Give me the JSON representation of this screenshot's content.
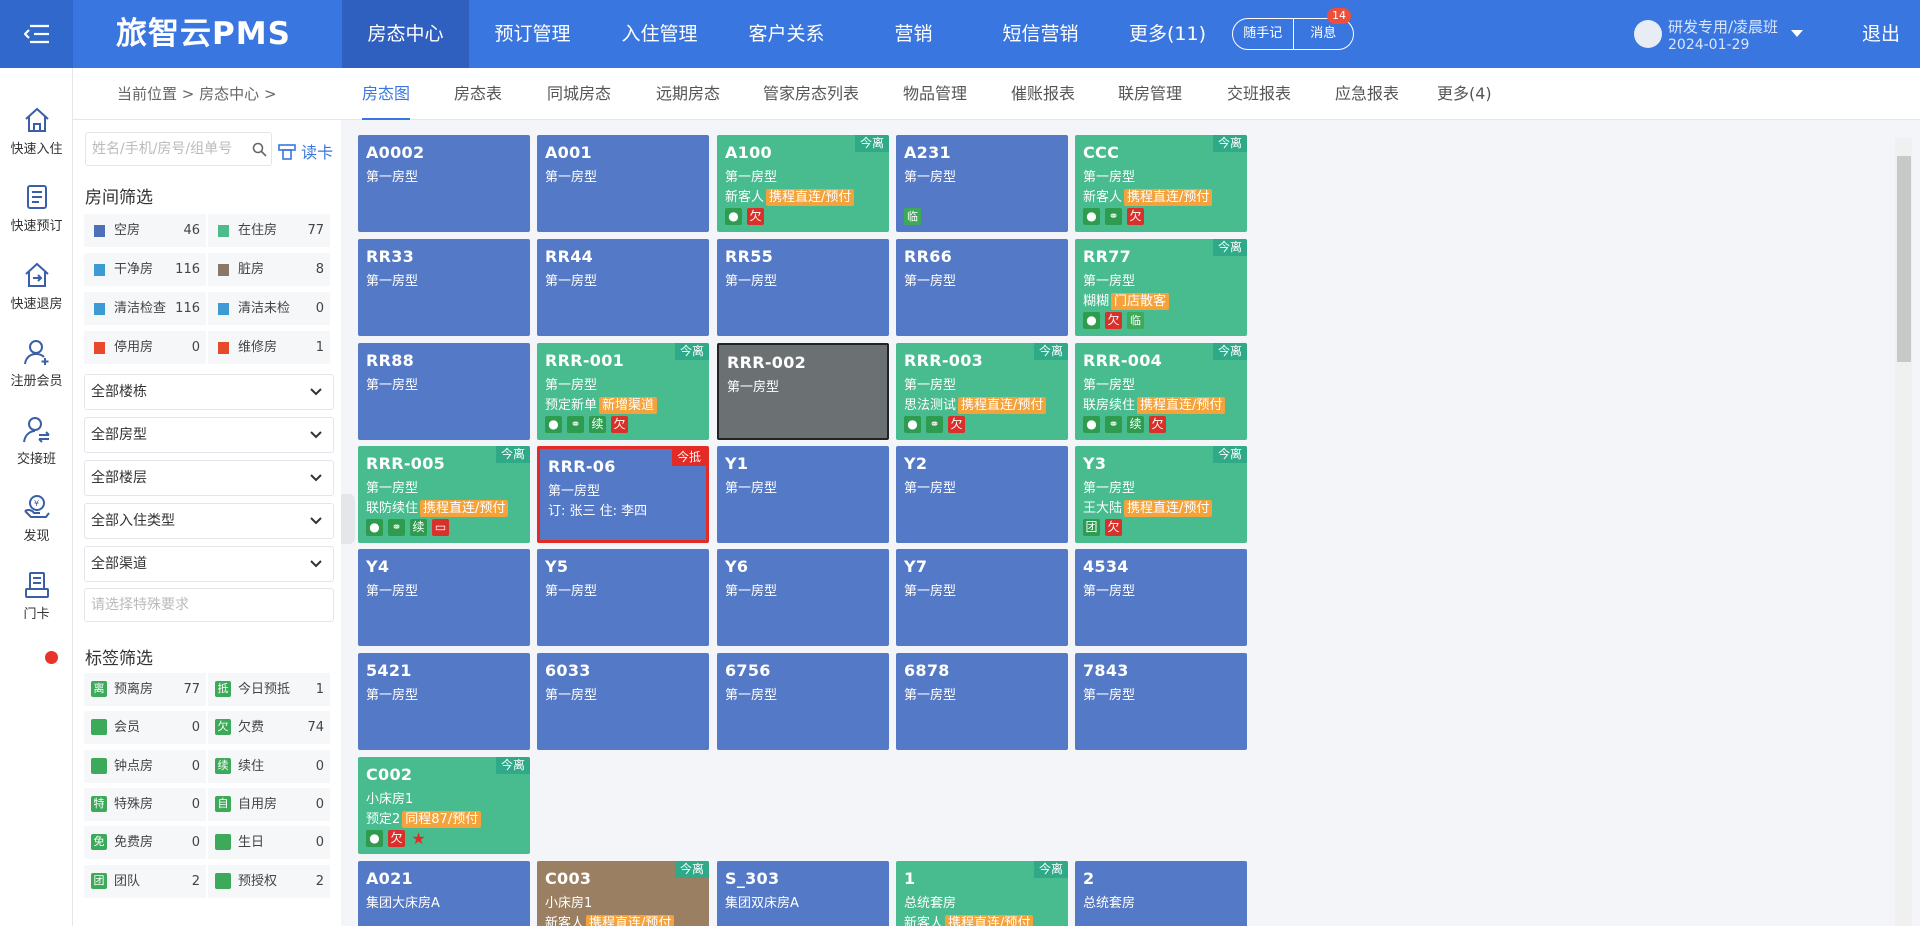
{
  "app": {
    "logo": "旅智云PMS",
    "logout": "退出",
    "user_name": "研发专用/凌晨班",
    "user_date": "2024-01-29",
    "memo_label": "随手记",
    "msg_label": "消息",
    "msg_count": "14"
  },
  "topnav": [
    {
      "label": "房态中心"
    },
    {
      "label": "预订管理"
    },
    {
      "label": "入住管理"
    },
    {
      "label": "客户关系"
    },
    {
      "label": "营销"
    },
    {
      "label": "短信营销"
    },
    {
      "label": "更多(11)"
    }
  ],
  "leftbar": [
    {
      "label": "快速入住",
      "icon": "home-enter-icon"
    },
    {
      "label": "快速预订",
      "icon": "booking-icon"
    },
    {
      "label": "快速退房",
      "icon": "checkout-icon"
    },
    {
      "label": "注册会员",
      "icon": "user-add-icon"
    },
    {
      "label": "交接班",
      "icon": "handover-icon"
    },
    {
      "label": "发现",
      "icon": "discover-icon"
    },
    {
      "label": "门卡",
      "icon": "door-card-icon"
    }
  ],
  "breadcrumb": {
    "prefix": "当前位置",
    "current": "房态中心",
    "sep": ">"
  },
  "subtabs": [
    {
      "label": "房态图"
    },
    {
      "label": "房态表"
    },
    {
      "label": "同城房态"
    },
    {
      "label": "远期房态"
    },
    {
      "label": "管家房态列表"
    },
    {
      "label": "物品管理"
    },
    {
      "label": "催账报表"
    },
    {
      "label": "联房管理"
    },
    {
      "label": "交班报表"
    },
    {
      "label": "应急报表"
    },
    {
      "label": "更多(4)"
    }
  ],
  "filter": {
    "search_placeholder": "姓名/手机/房号/组单号",
    "read_card": "读卡",
    "room_filter_title": "房间筛选",
    "statuses": [
      {
        "label": "空房",
        "count": "46",
        "color": "#4f6fb8"
      },
      {
        "label": "在住房",
        "count": "77",
        "color": "#4dbb8c"
      },
      {
        "label": "干净房",
        "count": "116",
        "color": "#3d9bd4"
      },
      {
        "label": "脏房",
        "count": "8",
        "color": "#8a7766"
      },
      {
        "label": "清洁检查",
        "count": "116",
        "color": "#3d9bd4"
      },
      {
        "label": "清洁未检",
        "count": "0",
        "color": "#3d9bd4"
      },
      {
        "label": "停用房",
        "count": "0",
        "color": "#e64a2e"
      },
      {
        "label": "维修房",
        "count": "1",
        "color": "#e64a2e"
      }
    ],
    "selects": [
      {
        "label": "全部楼栋"
      },
      {
        "label": "全部房型"
      },
      {
        "label": "全部楼层"
      },
      {
        "label": "全部入住类型"
      },
      {
        "label": "全部渠道"
      }
    ],
    "special_placeholder": "请选择特殊要求",
    "tag_filter_title": "标签筛选",
    "tags": [
      {
        "glyph": "离",
        "label": "预离房",
        "count": "77"
      },
      {
        "glyph": "抵",
        "label": "今日预抵",
        "count": "1"
      },
      {
        "glyph": "",
        "label": "会员",
        "count": "0"
      },
      {
        "glyph": "欠",
        "label": "欠费",
        "count": "74"
      },
      {
        "glyph": "",
        "label": "钟点房",
        "count": "0"
      },
      {
        "glyph": "续",
        "label": "续住",
        "count": "0"
      },
      {
        "glyph": "特",
        "label": "特殊房",
        "count": "0"
      },
      {
        "glyph": "自",
        "label": "自用房",
        "count": "0"
      },
      {
        "glyph": "免",
        "label": "免费房",
        "count": "0"
      },
      {
        "glyph": "",
        "label": "生日",
        "count": "0"
      },
      {
        "glyph": "团",
        "label": "团队",
        "count": "2"
      },
      {
        "glyph": "",
        "label": "预授权",
        "count": "2"
      }
    ]
  },
  "rooms": [
    {
      "no": "A0002",
      "type": "第一房型",
      "color": "blue"
    },
    {
      "no": "A001",
      "type": "第一房型",
      "color": "blue"
    },
    {
      "no": "A100",
      "type": "第一房型",
      "color": "green",
      "corner": "今离",
      "guest": "新客人",
      "source": "携程直连/预付",
      "icons": [
        "person",
        "owe"
      ]
    },
    {
      "no": "A231",
      "type": "第一房型",
      "color": "blue",
      "icons": [
        "temp"
      ]
    },
    {
      "no": "CCC",
      "type": "第一房型",
      "color": "green",
      "corner": "今离",
      "guest": "新客人",
      "source": "携程直连/预付",
      "icons": [
        "person",
        "link",
        "owe"
      ]
    },
    {
      "no": "RR33",
      "type": "第一房型",
      "color": "blue"
    },
    {
      "no": "RR44",
      "type": "第一房型",
      "color": "blue"
    },
    {
      "no": "RR55",
      "type": "第一房型",
      "color": "blue"
    },
    {
      "no": "RR66",
      "type": "第一房型",
      "color": "blue"
    },
    {
      "no": "RR77",
      "type": "第一房型",
      "color": "green",
      "corner": "今离",
      "guest": "糊糊",
      "source": "门店散客",
      "icons": [
        "person",
        "owe",
        "temp"
      ]
    },
    {
      "no": "RR88",
      "type": "第一房型",
      "color": "blue"
    },
    {
      "no": "RRR-001",
      "type": "第一房型",
      "color": "green",
      "corner": "今离",
      "guest": "预定新单",
      "source": "新增渠道",
      "icons": [
        "person",
        "link",
        "cont",
        "owe"
      ]
    },
    {
      "no": "RRR-002",
      "type": "第一房型",
      "color": "gray"
    },
    {
      "no": "RRR-003",
      "type": "第一房型",
      "color": "green",
      "corner": "今离",
      "guest": "思法测试",
      "source": "携程直连/预付",
      "icons": [
        "person",
        "link",
        "owe"
      ]
    },
    {
      "no": "RRR-004",
      "type": "第一房型",
      "color": "green",
      "corner": "今离",
      "guest": "联房续住",
      "source": "携程直连/预付",
      "icons": [
        "person",
        "link",
        "cont",
        "owe"
      ]
    },
    {
      "no": "RRR-005",
      "type": "第一房型",
      "color": "green",
      "corner": "今离",
      "guest": "联防续住",
      "source": "携程直连/预付",
      "icons": [
        "person",
        "link",
        "cont",
        "card"
      ]
    },
    {
      "no": "RRR-06",
      "type": "第一房型",
      "color": "blue",
      "selected": true,
      "corner": "今抵",
      "corner_red": true,
      "guest": "订: 张三 住: 李四"
    },
    {
      "no": "Y1",
      "type": "第一房型",
      "color": "blue"
    },
    {
      "no": "Y2",
      "type": "第一房型",
      "color": "blue"
    },
    {
      "no": "Y3",
      "type": "第一房型",
      "color": "green",
      "corner": "今离",
      "guest": "王大陆",
      "source": "携程直连/预付",
      "icons": [
        "group",
        "owe"
      ]
    },
    {
      "no": "Y4",
      "type": "第一房型",
      "color": "blue"
    },
    {
      "no": "Y5",
      "type": "第一房型",
      "color": "blue"
    },
    {
      "no": "Y6",
      "type": "第一房型",
      "color": "blue"
    },
    {
      "no": "Y7",
      "type": "第一房型",
      "color": "blue"
    },
    {
      "no": "4534",
      "type": "第一房型",
      "color": "blue"
    },
    {
      "no": "5421",
      "type": "第一房型",
      "color": "blue"
    },
    {
      "no": "6033",
      "type": "第一房型",
      "color": "blue"
    },
    {
      "no": "6756",
      "type": "第一房型",
      "color": "blue"
    },
    {
      "no": "6878",
      "type": "第一房型",
      "color": "blue"
    },
    {
      "no": "7843",
      "type": "第一房型",
      "color": "blue"
    },
    {
      "no": "C002",
      "type": "小床房1",
      "color": "green",
      "corner": "今离",
      "guest": "预定2",
      "source": "同程87/预付",
      "icons": [
        "person",
        "owe",
        "star"
      ]
    },
    {
      "no": "A021",
      "type": "集团大床房A",
      "color": "blue"
    },
    {
      "no": "C003",
      "type": "小床房1",
      "color": "brown",
      "corner": "今离",
      "guest": "新客人",
      "source": "携程直连/预付"
    },
    {
      "no": "S_303",
      "type": "集团双床房A",
      "color": "blue"
    },
    {
      "no": "1",
      "type": "总统套房",
      "color": "green",
      "corner": "今离",
      "guest": "新客人",
      "source": "携程直连/预付"
    },
    {
      "no": "2",
      "type": "总统套房",
      "color": "blue"
    }
  ],
  "icon_glyphs": {
    "owe": "欠",
    "cont": "续",
    "temp": "临",
    "group": "团",
    "star": "★",
    "link": "⚭",
    "person": "●",
    "card": "▭"
  }
}
